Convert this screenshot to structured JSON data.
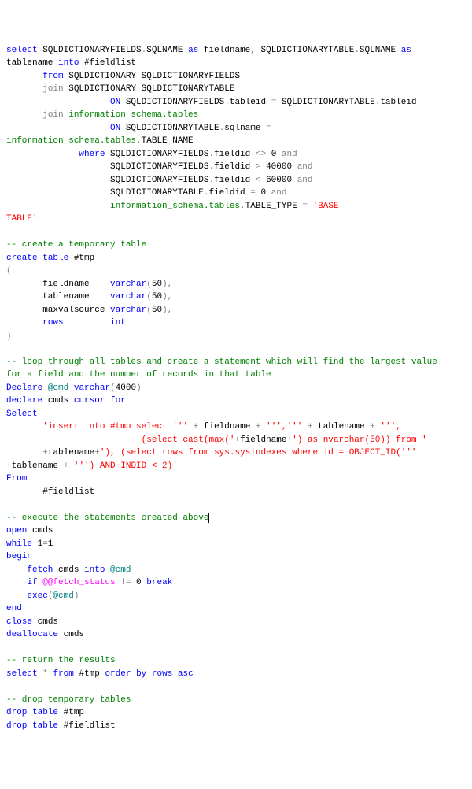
{
  "lines": [
    [
      [
        "k",
        "select"
      ],
      [
        "",
        " SQLDICTIONARYFIELDS"
      ],
      [
        "g",
        "."
      ],
      [
        "",
        "SQLNAME "
      ],
      [
        "k",
        "as"
      ],
      [
        "",
        " fieldname"
      ],
      [
        "g",
        ","
      ],
      [
        "",
        " SQLDICTIONARYTABLE"
      ],
      [
        "g",
        "."
      ],
      [
        "",
        "SQLNAME "
      ],
      [
        "k",
        "as"
      ]
    ],
    [
      [
        "",
        "tablename "
      ],
      [
        "k",
        "into"
      ],
      [
        "",
        " #fieldlist"
      ]
    ],
    [
      [
        "",
        "       "
      ],
      [
        "k",
        "from"
      ],
      [
        "",
        " SQLDICTIONARY SQLDICTIONARYFIELDS"
      ]
    ],
    [
      [
        "",
        "       "
      ],
      [
        "g",
        "join"
      ],
      [
        "",
        " SQLDICTIONARY SQLDICTIONARYTABLE"
      ]
    ],
    [
      [
        "",
        "                    "
      ],
      [
        "k",
        "ON"
      ],
      [
        "",
        " SQLDICTIONARYFIELDS"
      ],
      [
        "g",
        "."
      ],
      [
        "",
        "tableid "
      ],
      [
        "g",
        "="
      ],
      [
        "",
        " SQLDICTIONARYTABLE"
      ],
      [
        "g",
        "."
      ],
      [
        "",
        "tableid"
      ]
    ],
    [
      [
        "",
        "       "
      ],
      [
        "g",
        "join"
      ],
      [
        "",
        " "
      ],
      [
        "c",
        "information_schema.tables"
      ]
    ],
    [
      [
        "",
        "                    "
      ],
      [
        "k",
        "ON"
      ],
      [
        "",
        " SQLDICTIONARYTABLE"
      ],
      [
        "g",
        "."
      ],
      [
        "",
        "sqlname "
      ],
      [
        "g",
        "="
      ]
    ],
    [
      [
        "c",
        "information_schema.tables"
      ],
      [
        "g",
        "."
      ],
      [
        "",
        "TABLE_NAME"
      ]
    ],
    [
      [
        "",
        "              "
      ],
      [
        "k",
        "where"
      ],
      [
        "",
        " SQLDICTIONARYFIELDS"
      ],
      [
        "g",
        "."
      ],
      [
        "",
        "fieldid "
      ],
      [
        "g",
        "<>"
      ],
      [
        "",
        " 0 "
      ],
      [
        "g",
        "and"
      ]
    ],
    [
      [
        "",
        "                    SQLDICTIONARYFIELDS"
      ],
      [
        "g",
        "."
      ],
      [
        "",
        "fieldid "
      ],
      [
        "g",
        ">"
      ],
      [
        "",
        " 40000 "
      ],
      [
        "g",
        "and"
      ]
    ],
    [
      [
        "",
        "                    SQLDICTIONARYFIELDS"
      ],
      [
        "g",
        "."
      ],
      [
        "",
        "fieldid "
      ],
      [
        "g",
        "<"
      ],
      [
        "",
        " 60000 "
      ],
      [
        "g",
        "and"
      ]
    ],
    [
      [
        "",
        "                    SQLDICTIONARYTABLE"
      ],
      [
        "g",
        "."
      ],
      [
        "",
        "fieldid "
      ],
      [
        "g",
        "="
      ],
      [
        "",
        " 0 "
      ],
      [
        "g",
        "and"
      ]
    ],
    [
      [
        "",
        "                    "
      ],
      [
        "c",
        "information_schema.tables"
      ],
      [
        "g",
        "."
      ],
      [
        "",
        "TABLE_TYPE "
      ],
      [
        "g",
        "="
      ],
      [
        "",
        " "
      ],
      [
        "s",
        "'BASE"
      ]
    ],
    [
      [
        "s",
        "TABLE'"
      ]
    ],
    [
      [
        "",
        " "
      ]
    ],
    [
      [
        "c",
        "-- create a temporary table"
      ]
    ],
    [
      [
        "k",
        "create"
      ],
      [
        "",
        " "
      ],
      [
        "k",
        "table"
      ],
      [
        "",
        " #tmp"
      ]
    ],
    [
      [
        "g",
        "("
      ]
    ],
    [
      [
        "",
        "       fieldname    "
      ],
      [
        "k",
        "varchar"
      ],
      [
        "g",
        "("
      ],
      [
        "",
        "50"
      ],
      [
        "g",
        ")"
      ],
      [
        "g",
        ","
      ]
    ],
    [
      [
        "",
        "       tablename    "
      ],
      [
        "k",
        "varchar"
      ],
      [
        "g",
        "("
      ],
      [
        "",
        "50"
      ],
      [
        "g",
        ")"
      ],
      [
        "g",
        ","
      ]
    ],
    [
      [
        "",
        "       maxvalsource "
      ],
      [
        "k",
        "varchar"
      ],
      [
        "g",
        "("
      ],
      [
        "",
        "50"
      ],
      [
        "g",
        ")"
      ],
      [
        "g",
        ","
      ]
    ],
    [
      [
        "",
        "       "
      ],
      [
        "k",
        "rows"
      ],
      [
        "",
        "         "
      ],
      [
        "k",
        "int"
      ]
    ],
    [
      [
        "g",
        ")"
      ]
    ],
    [
      [
        "",
        " "
      ]
    ],
    [
      [
        "c",
        "-- loop through all tables and create a statement which will find the largest value"
      ]
    ],
    [
      [
        "c",
        "for a field and the number of records in that table"
      ]
    ],
    [
      [
        "k",
        "Declare"
      ],
      [
        "",
        " "
      ],
      [
        "t",
        "@cmd"
      ],
      [
        "",
        " "
      ],
      [
        "k",
        "varchar"
      ],
      [
        "g",
        "("
      ],
      [
        "",
        "4000"
      ],
      [
        "g",
        ")"
      ]
    ],
    [
      [
        "k",
        "declare"
      ],
      [
        "",
        " cmds "
      ],
      [
        "k",
        "cursor"
      ],
      [
        "",
        " "
      ],
      [
        "k",
        "for"
      ]
    ],
    [
      [
        "k",
        "Select"
      ]
    ],
    [
      [
        "",
        "       "
      ],
      [
        "s",
        "'insert into #tmp select '''"
      ],
      [
        "",
        " "
      ],
      [
        "g",
        "+"
      ],
      [
        "",
        " fieldname "
      ],
      [
        "g",
        "+"
      ],
      [
        "",
        " "
      ],
      [
        "s",
        "''','''"
      ],
      [
        "",
        " "
      ],
      [
        "g",
        "+"
      ],
      [
        "",
        " tablename "
      ],
      [
        "g",
        "+"
      ],
      [
        "",
        " "
      ],
      [
        "s",
        "''',"
      ]
    ],
    [
      [
        "s",
        "                          (select cast(max('"
      ],
      [
        "g",
        "+"
      ],
      [
        "",
        "fieldname"
      ],
      [
        "g",
        "+"
      ],
      [
        "s",
        "') as nvarchar(50)) from '"
      ]
    ],
    [
      [
        "",
        "       "
      ],
      [
        "g",
        "+"
      ],
      [
        "",
        "tablename"
      ],
      [
        "g",
        "+"
      ],
      [
        "s",
        "'), (select rows from sys.sysindexes where id = OBJECT_ID('''"
      ]
    ],
    [
      [
        "g",
        "+"
      ],
      [
        "",
        "tablename "
      ],
      [
        "g",
        "+"
      ],
      [
        "",
        " "
      ],
      [
        "s",
        "''') AND INDID < 2)'"
      ]
    ],
    [
      [
        "k",
        "From"
      ]
    ],
    [
      [
        "",
        "       #fieldlist"
      ]
    ],
    [
      [
        "",
        " "
      ]
    ],
    [
      [
        "c",
        "-- execute the statements created above"
      ],
      [
        "cur",
        " "
      ]
    ],
    [
      [
        "k",
        "open"
      ],
      [
        "",
        " cmds"
      ]
    ],
    [
      [
        "k",
        "while"
      ],
      [
        "",
        " 1"
      ],
      [
        "g",
        "="
      ],
      [
        "",
        "1"
      ]
    ],
    [
      [
        "k",
        "begin"
      ]
    ],
    [
      [
        "",
        "    "
      ],
      [
        "k",
        "fetch"
      ],
      [
        "",
        " cmds "
      ],
      [
        "k",
        "into"
      ],
      [
        "",
        " "
      ],
      [
        "t",
        "@cmd"
      ]
    ],
    [
      [
        "",
        "    "
      ],
      [
        "k",
        "if"
      ],
      [
        "",
        " "
      ],
      [
        "f",
        "@@fetch_status"
      ],
      [
        "",
        " "
      ],
      [
        "g",
        "!="
      ],
      [
        "",
        " 0 "
      ],
      [
        "k",
        "break"
      ]
    ],
    [
      [
        "",
        "    "
      ],
      [
        "k",
        "exec"
      ],
      [
        "g",
        "("
      ],
      [
        "t",
        "@cmd"
      ],
      [
        "g",
        ")"
      ]
    ],
    [
      [
        "k",
        "end"
      ]
    ],
    [
      [
        "k",
        "close"
      ],
      [
        "",
        " cmds"
      ]
    ],
    [
      [
        "k",
        "deallocate"
      ],
      [
        "",
        " cmds"
      ]
    ],
    [
      [
        "",
        " "
      ]
    ],
    [
      [
        "c",
        "-- return the results"
      ]
    ],
    [
      [
        "k",
        "select"
      ],
      [
        "",
        " "
      ],
      [
        "g",
        "*"
      ],
      [
        "",
        " "
      ],
      [
        "k",
        "from"
      ],
      [
        "",
        " #tmp "
      ],
      [
        "k",
        "order"
      ],
      [
        "",
        " "
      ],
      [
        "k",
        "by"
      ],
      [
        "",
        " "
      ],
      [
        "k",
        "rows"
      ],
      [
        "",
        " "
      ],
      [
        "k",
        "asc"
      ]
    ],
    [
      [
        "",
        " "
      ]
    ],
    [
      [
        "c",
        "-- drop temporary tables"
      ]
    ],
    [
      [
        "k",
        "drop"
      ],
      [
        "",
        " "
      ],
      [
        "k",
        "table"
      ],
      [
        "",
        " #tmp"
      ]
    ],
    [
      [
        "k",
        "drop"
      ],
      [
        "",
        " "
      ],
      [
        "k",
        "table"
      ],
      [
        "",
        " #fieldlist"
      ]
    ]
  ]
}
